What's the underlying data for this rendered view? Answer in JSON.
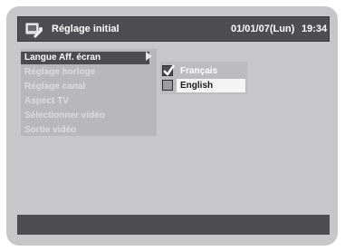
{
  "header": {
    "icon": "settings-tool-icon",
    "title": "Réglage initial",
    "date": "01/01/07(Lun)",
    "time": "19:34"
  },
  "menu": {
    "items": [
      {
        "label": "Langue Aff. écran",
        "selected": true
      },
      {
        "label": "Réglage horloge"
      },
      {
        "label": "Réglage canal"
      },
      {
        "label": "Aspect TV"
      },
      {
        "label": "Sélectionner vidéo"
      },
      {
        "label": "Sortie vidéo"
      }
    ]
  },
  "language_options": [
    {
      "label": "Français",
      "checked": true
    },
    {
      "label": "English",
      "checked": false,
      "highlighted": true
    }
  ],
  "colors": {
    "background": "#c7c7c9",
    "bar": "#4e4e52",
    "highlight": "#f4f4f5"
  }
}
